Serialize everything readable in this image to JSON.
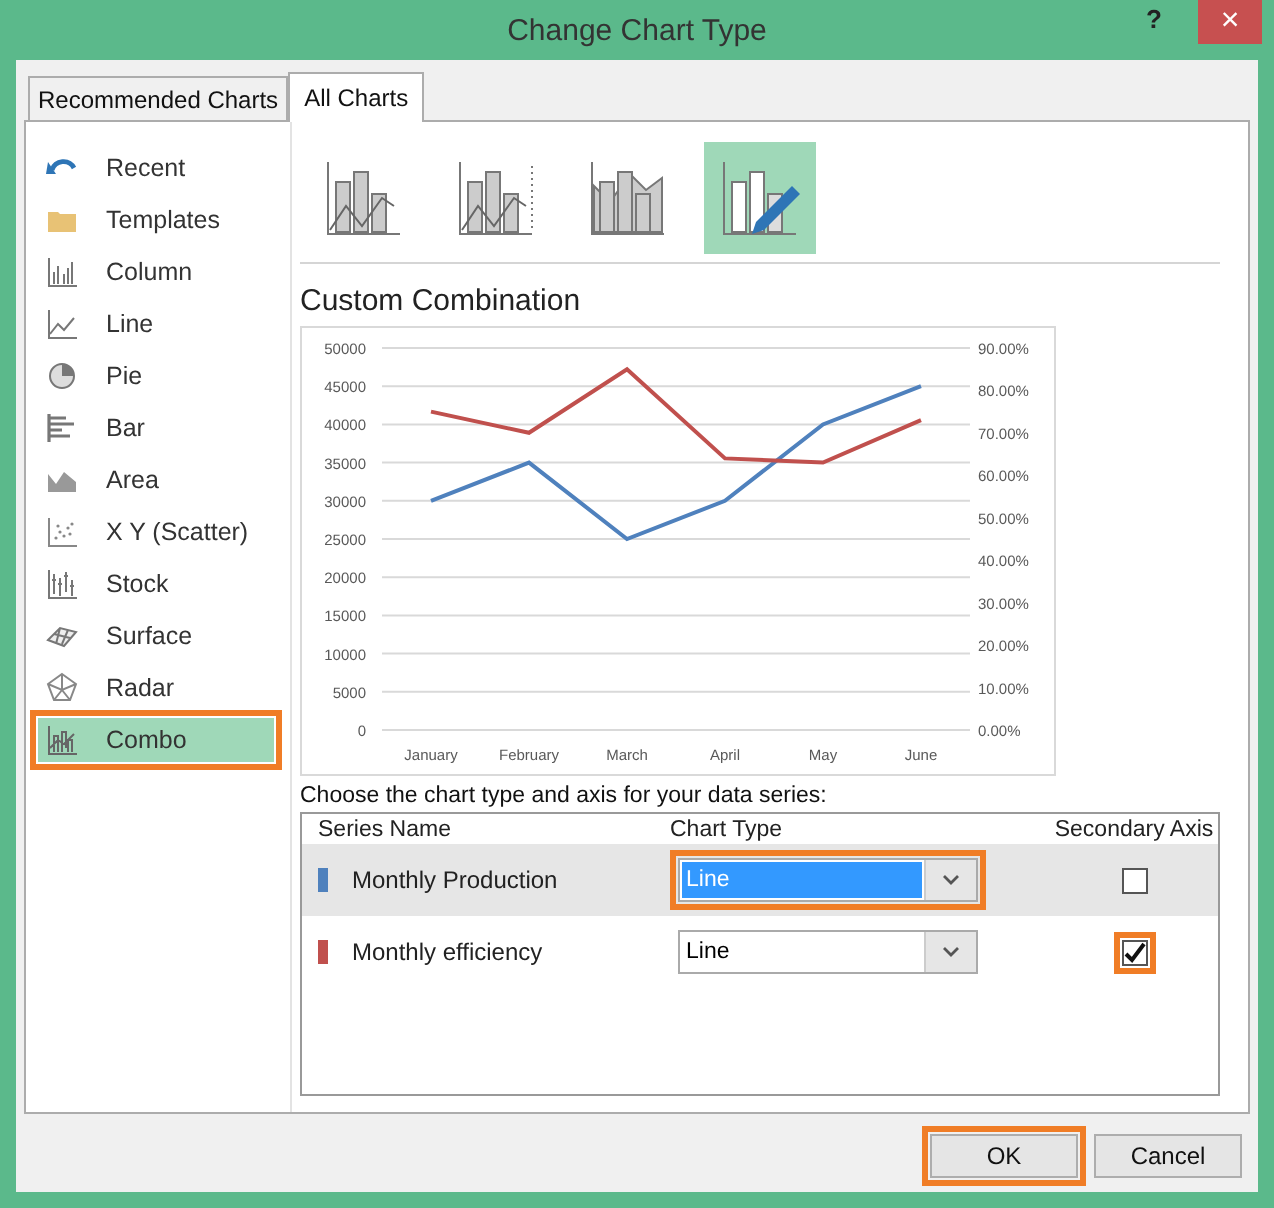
{
  "window": {
    "title": "Change Chart Type",
    "help": "?",
    "close": "×"
  },
  "tabs": [
    {
      "label": "Recommended Charts",
      "selected": false
    },
    {
      "label": "All Charts",
      "selected": true
    }
  ],
  "sidebar": {
    "items": [
      {
        "label": "Recent",
        "selected": false,
        "highlighted": false
      },
      {
        "label": "Templates",
        "selected": false,
        "highlighted": false
      },
      {
        "label": "Column",
        "selected": false,
        "highlighted": false
      },
      {
        "label": "Line",
        "selected": false,
        "highlighted": false
      },
      {
        "label": "Pie",
        "selected": false,
        "highlighted": false
      },
      {
        "label": "Bar",
        "selected": false,
        "highlighted": false
      },
      {
        "label": "Area",
        "selected": false,
        "highlighted": false
      },
      {
        "label": "X Y (Scatter)",
        "selected": false,
        "highlighted": false
      },
      {
        "label": "Stock",
        "selected": false,
        "highlighted": false
      },
      {
        "label": "Surface",
        "selected": false,
        "highlighted": false
      },
      {
        "label": "Radar",
        "selected": false,
        "highlighted": false
      },
      {
        "label": "Combo",
        "selected": true,
        "highlighted": true
      }
    ]
  },
  "subtypes": [
    {
      "selected": false
    },
    {
      "selected": false
    },
    {
      "selected": false
    },
    {
      "selected": true
    }
  ],
  "heading": "Custom Combination",
  "chart_data": {
    "type": "line",
    "categories": [
      "January",
      "February",
      "March",
      "April",
      "May",
      "June"
    ],
    "series": [
      {
        "color": "#4f81bd",
        "values": [
          30000,
          35000,
          25000,
          30000,
          40000,
          45000
        ]
      },
      {
        "color": "#c0504d",
        "axis": "y2",
        "values": [
          0.75,
          0.7,
          0.85,
          0.64,
          0.63,
          0.73
        ]
      }
    ],
    "grid": true,
    "ylim": [
      0,
      50000
    ],
    "y2lim": [
      0,
      0.9
    ],
    "yticks": [
      0,
      5000,
      10000,
      15000,
      20000,
      25000,
      30000,
      35000,
      40000,
      45000,
      50000
    ],
    "y2ticks": [
      {
        "value": 0,
        "label": "0.00%"
      },
      {
        "value": 0.1,
        "label": "10.00%"
      },
      {
        "value": 0.2,
        "label": "20.00%"
      },
      {
        "value": 0.3,
        "label": "30.00%"
      },
      {
        "value": 0.4,
        "label": "40.00%"
      },
      {
        "value": 0.5,
        "label": "50.00%"
      },
      {
        "value": 0.6,
        "label": "60.00%"
      },
      {
        "value": 0.7,
        "label": "70.00%"
      },
      {
        "value": 0.8,
        "label": "80.00%"
      },
      {
        "value": 0.9,
        "label": "90.00%"
      }
    ]
  },
  "series_prompt": "Choose the chart type and axis for your data series:",
  "series_table": {
    "columns": [
      "Series Name",
      "Chart Type",
      "Secondary Axis"
    ],
    "rows": [
      {
        "name": "Monthly Production",
        "color": "#4f81bd",
        "chart_type": "Line",
        "secondary_axis": false,
        "selected": true,
        "type_highlighted": true,
        "axis_highlighted": false
      },
      {
        "name": "Monthly efficiency",
        "color": "#c0504d",
        "chart_type": "Line",
        "secondary_axis": true,
        "selected": false,
        "type_highlighted": false,
        "axis_highlighted": true
      }
    ]
  },
  "buttons": [
    {
      "label": "OK",
      "highlighted": true
    },
    {
      "label": "Cancel",
      "highlighted": false
    }
  ]
}
